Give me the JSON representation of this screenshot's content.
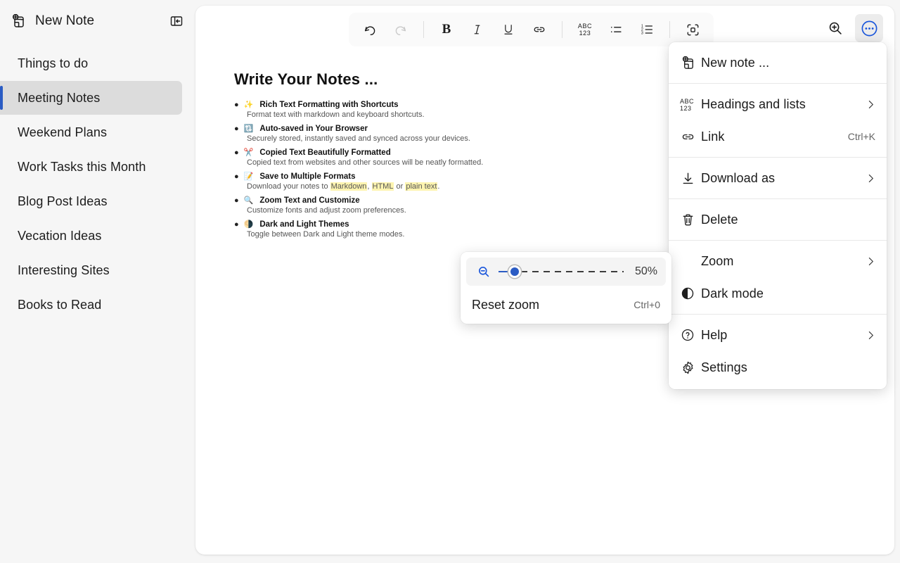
{
  "sidebar": {
    "new_note_label": "New Note",
    "new_note_icon": "new-note-icon",
    "collapse_icon": "collapse-sidebar-icon",
    "items": [
      {
        "label": "Things to do",
        "selected": false
      },
      {
        "label": "Meeting Notes",
        "selected": true
      },
      {
        "label": "Weekend Plans",
        "selected": false
      },
      {
        "label": "Work Tasks this Month",
        "selected": false
      },
      {
        "label": "Blog Post Ideas",
        "selected": false
      },
      {
        "label": "Vecation Ideas",
        "selected": false
      },
      {
        "label": "Interesting Sites",
        "selected": false
      },
      {
        "label": "Books to Read",
        "selected": false
      }
    ],
    "selected_accent_color": "#2b5cc4",
    "selected_bg_color": "#dcdcdc"
  },
  "toolbar": {
    "undo_label": "Undo",
    "redo_label": "Redo",
    "bold_label": "B",
    "italic_label": "I",
    "underline_label": "U",
    "link_label": "Link",
    "headings_label": "Headings and lists",
    "bullet_list_label": "Bulleted list",
    "numbered_list_label": "Numbered list",
    "focus_label": "Focus mode",
    "zoom_in_label": "Zoom in",
    "more_label": "More options",
    "more_accent_color": "#1a56db"
  },
  "document": {
    "title": "Write Your Notes ...",
    "bullets": [
      {
        "emoji": "✨",
        "title": "Rich Text Formatting with Shortcuts",
        "desc": "Format text with markdown and keyboard shortcuts."
      },
      {
        "emoji": "🔃",
        "title": "Auto-saved in Your Browser",
        "desc": "Securely stored, instantly saved and synced across your devices."
      },
      {
        "emoji": "✂️",
        "title": "Copied Text Beautifully Formatted",
        "desc": "Copied text from websites and other sources will be neatly formatted."
      },
      {
        "emoji": "📝",
        "title": "Save to Multiple Formats",
        "desc_parts": [
          {
            "text": "Download your notes to ",
            "highlight": false
          },
          {
            "text": "Markdown",
            "highlight": true
          },
          {
            "text": ", ",
            "highlight": false
          },
          {
            "text": "HTML",
            "highlight": true
          },
          {
            "text": " or ",
            "highlight": false
          },
          {
            "text": "plain text",
            "highlight": true
          },
          {
            "text": ".",
            "highlight": false
          }
        ]
      },
      {
        "emoji": "🔍",
        "title": "Zoom Text and Customize",
        "desc": "Customize fonts and adjust zoom preferences."
      },
      {
        "emoji": "🌗",
        "title": "Dark and Light Themes",
        "desc": "Toggle between Dark and Light theme modes."
      }
    ],
    "highlight_color": "#fdf4b0"
  },
  "main_menu": {
    "items": [
      {
        "label": "New note ...",
        "icon": "new-note-icon",
        "hint": "",
        "chevron": false
      },
      {
        "label": "Headings and lists",
        "icon": "abc123-icon",
        "hint": "",
        "chevron": true
      },
      {
        "label": "Link",
        "icon": "link-icon",
        "hint": "Ctrl+K",
        "chevron": false
      },
      {
        "label": "Download as",
        "icon": "download-icon",
        "hint": "",
        "chevron": true
      },
      {
        "label": "Delete",
        "icon": "trash-icon",
        "hint": "",
        "chevron": false
      },
      {
        "label": "Zoom",
        "icon": "",
        "hint": "",
        "chevron": true
      },
      {
        "label": "Dark mode",
        "icon": "half-circle-icon",
        "hint": "",
        "chevron": false
      },
      {
        "label": "Help",
        "icon": "question-circle-icon",
        "hint": "",
        "chevron": true
      },
      {
        "label": "Settings",
        "icon": "gear-icon",
        "hint": "",
        "chevron": false
      }
    ]
  },
  "zoom_menu": {
    "zoom_out_icon": "zoom-out-icon",
    "percent": "50%",
    "slider_value": 50,
    "slider_min": 0,
    "slider_max": 100,
    "accent_color": "#2b5cc4",
    "reset_label": "Reset zoom",
    "reset_hint": "Ctrl+0"
  }
}
